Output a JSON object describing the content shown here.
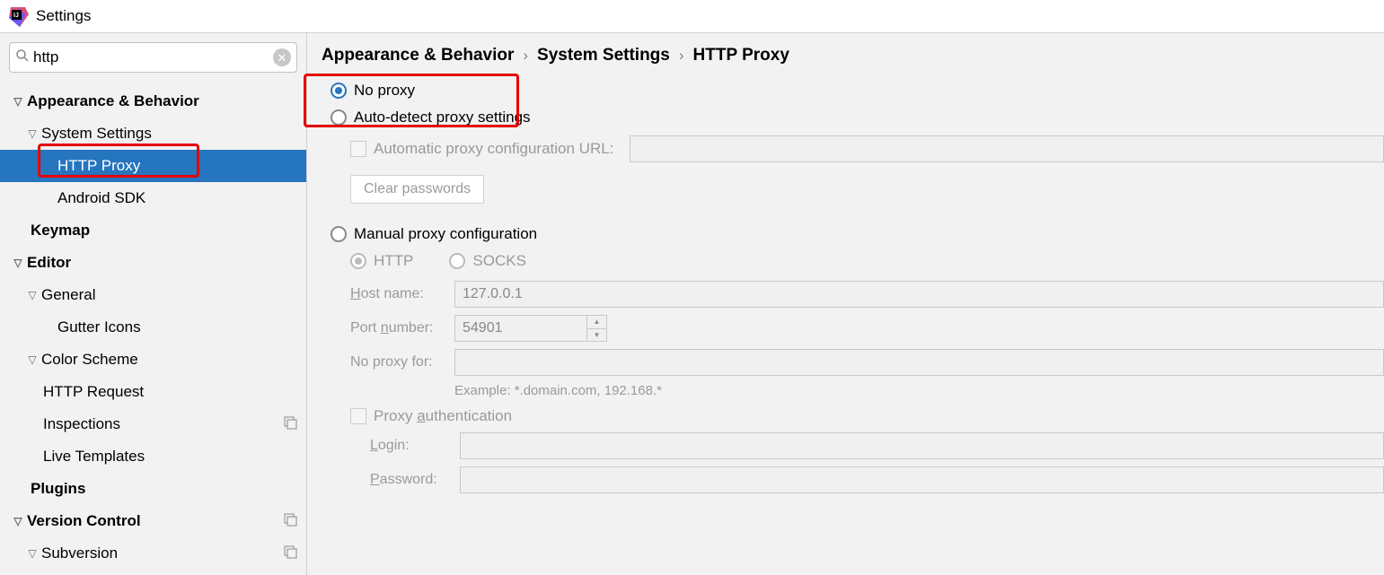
{
  "title": "Settings",
  "search_value": "http",
  "sidebar": {
    "appearance": "Appearance & Behavior",
    "system_settings": "System Settings",
    "http_proxy": "HTTP Proxy",
    "android_sdk": "Android SDK",
    "keymap": "Keymap",
    "editor": "Editor",
    "general": "General",
    "gutter_icons": "Gutter Icons",
    "color_scheme": "Color Scheme",
    "http_request": "HTTP Request",
    "inspections": "Inspections",
    "live_templates": "Live Templates",
    "plugins": "Plugins",
    "version_control": "Version Control",
    "subversion": "Subversion"
  },
  "breadcrumb": {
    "a": "Appearance & Behavior",
    "b": "System Settings",
    "c": "HTTP Proxy"
  },
  "proxy": {
    "no_proxy": "No proxy",
    "auto_detect": "Auto-detect proxy settings",
    "auto_url_label": "Automatic proxy configuration URL:",
    "clear_passwords": "Clear passwords",
    "manual": "Manual proxy configuration",
    "http": "HTTP",
    "socks": "SOCKS",
    "host_label": "Host name:",
    "host_value": "127.0.0.1",
    "port_label": "Port number:",
    "port_value": "54901",
    "noproxyfor_label": "No proxy for:",
    "example": "Example: *.domain.com, 192.168.*",
    "proxy_auth": "Proxy authentication",
    "login_label": "Login:",
    "password_label": "Password:"
  }
}
